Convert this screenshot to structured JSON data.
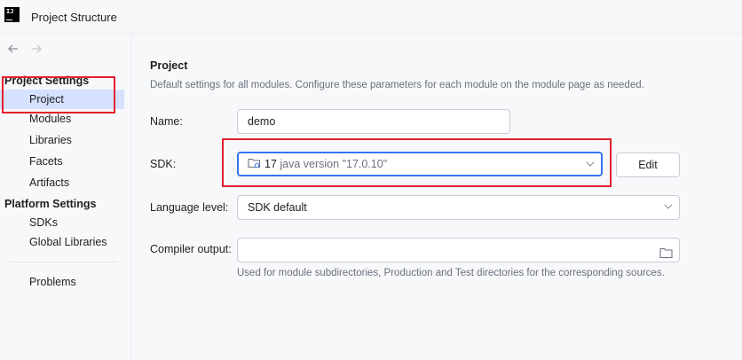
{
  "window": {
    "title": "Project Structure",
    "logo_text": "IJ"
  },
  "nav": {
    "back_icon": "arrow-left-icon",
    "forward_icon": "arrow-right-icon"
  },
  "sidebar": {
    "project_settings_title": "Project Settings",
    "project_settings_items": [
      {
        "label": "Project",
        "selected": true
      },
      {
        "label": "Modules"
      },
      {
        "label": "Libraries"
      },
      {
        "label": "Facets"
      },
      {
        "label": "Artifacts"
      }
    ],
    "platform_settings_title": "Platform Settings",
    "platform_settings_items": [
      {
        "label": "SDKs"
      },
      {
        "label": "Global Libraries"
      }
    ],
    "problems_label": "Problems"
  },
  "main": {
    "title": "Project",
    "description": "Default settings for all modules. Configure these parameters for each module on the module page as needed.",
    "name_label": "Name:",
    "name_value": "demo",
    "sdk_label": "SDK:",
    "sdk_number": "17",
    "sdk_version": "java version \"17.0.10\"",
    "sdk_icon": "folder-icon",
    "edit_button": "Edit",
    "language_level_label": "Language level:",
    "language_level_value": "SDK default",
    "compiler_output_label": "Compiler output:",
    "compiler_output_value": "",
    "compiler_output_hint": "Used for module subdirectories, Production and Test directories for the corresponding sources."
  },
  "colors": {
    "selection": "#d5e1ff",
    "focus_border": "#3574f0",
    "annotation_red": "#e3212b"
  }
}
